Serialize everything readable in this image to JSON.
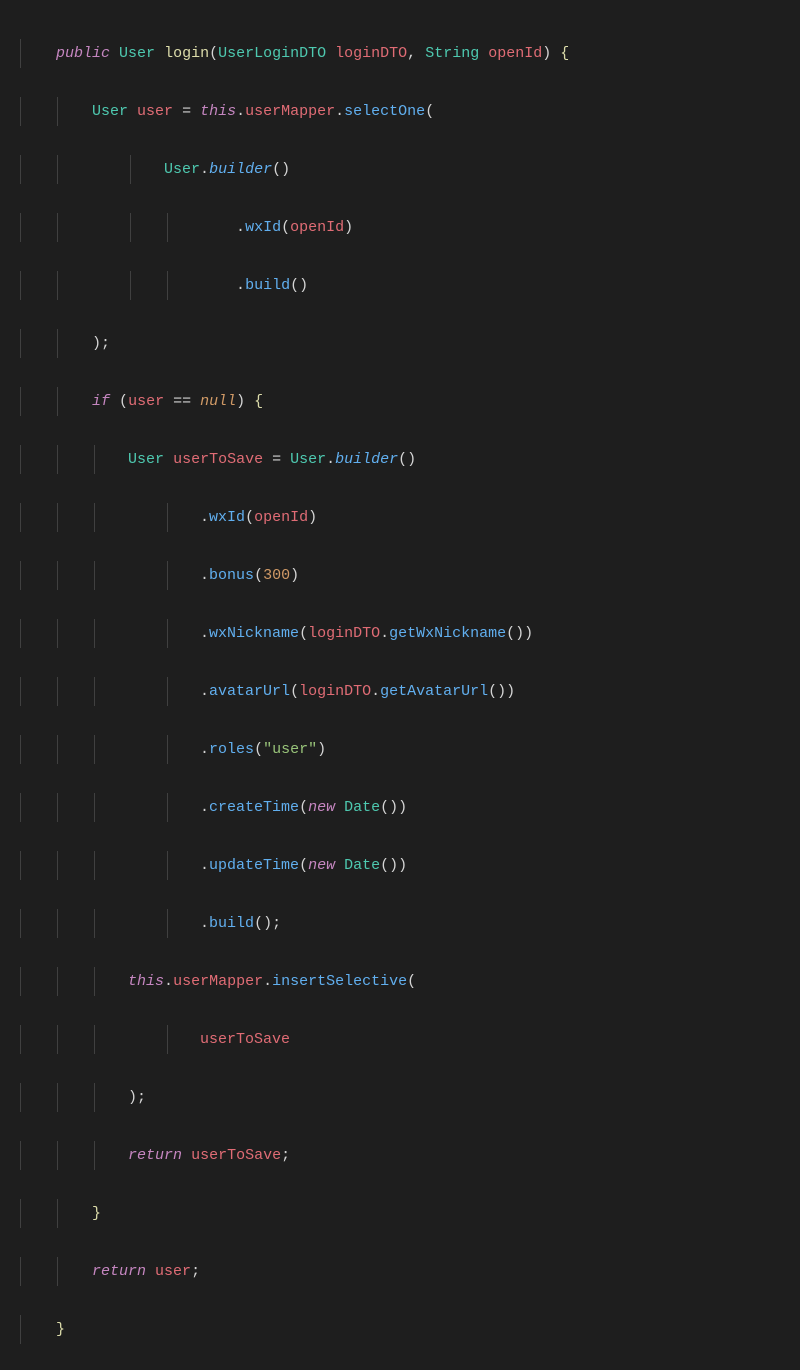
{
  "code": {
    "method_signature": {
      "modifier": "public",
      "return_type": "User",
      "name": "login",
      "param1_type": "UserLoginDTO",
      "param1_name": "loginDTO",
      "param2_type": "String",
      "param2_name": "openId"
    },
    "l2": {
      "type": "User",
      "var": "user",
      "this": "this",
      "prop": "userMapper",
      "call": "selectOne"
    },
    "l3": {
      "type": "User",
      "call": "builder"
    },
    "l4": {
      "call": "wxId",
      "arg": "openId"
    },
    "l5": {
      "call": "build"
    },
    "l7": {
      "kw": "if",
      "var": "user",
      "null": "null"
    },
    "l8": {
      "type": "User",
      "var": "userToSave",
      "type2": "User",
      "call": "builder"
    },
    "l9": {
      "call": "wxId",
      "arg": "openId"
    },
    "l10": {
      "call": "bonus",
      "num": "300"
    },
    "l11": {
      "call": "wxNickname",
      "arg": "loginDTO",
      "arg2": "getWxNickname"
    },
    "l12": {
      "call": "avatarUrl",
      "arg": "loginDTO",
      "arg2": "getAvatarUrl"
    },
    "l13": {
      "call": "roles",
      "str": "\"user\""
    },
    "l14": {
      "call": "createTime",
      "new": "new",
      "type": "Date"
    },
    "l15": {
      "call": "updateTime",
      "new": "new",
      "type": "Date"
    },
    "l16": {
      "call": "build"
    },
    "l17": {
      "this": "this",
      "prop": "userMapper",
      "call": "insertSelective"
    },
    "l18": {
      "arg": "userToSave"
    },
    "l20": {
      "kw": "return",
      "var": "userToSave"
    },
    "l22": {
      "kw": "return",
      "var": "user"
    }
  }
}
